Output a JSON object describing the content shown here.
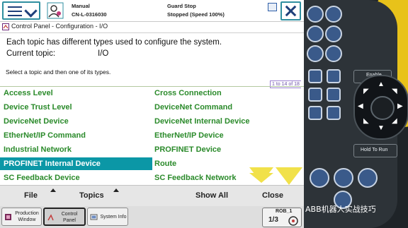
{
  "header": {
    "mode": "Manual",
    "controller_id": "CN-L-0316030",
    "guard_status": "Guard Stop",
    "motor_status": "Stopped (Speed 100%)"
  },
  "window_title": "Control Panel - Configuration - I/O",
  "description": "Each topic has different types used to configure the system.",
  "current_topic_label": "Current topic:",
  "current_topic_value": "I/O",
  "instruction": "Select a topic and then one of its types.",
  "range_indicator": "1 to 14 of 18",
  "types_left": [
    "Access Level",
    "Device Trust Level",
    "DeviceNet Device",
    "EtherNet/IP Command",
    "Industrial Network",
    "PROFINET Internal Device",
    "SC Feedback Device"
  ],
  "types_right": [
    "Cross Connection",
    "DeviceNet Command",
    "DeviceNet Internal Device",
    "EtherNet/IP Device",
    "PROFINET Device",
    "Route",
    "SC Feedback Network"
  ],
  "selected_item": "PROFINET Internal Device",
  "commands": {
    "file": "File",
    "topics": "Topics",
    "show_all": "Show All",
    "close": "Close"
  },
  "taskbar": {
    "production_window": "Production Window",
    "control_panel": "Control Panel",
    "system_info": "System Info",
    "rob_label": "ROB_1",
    "rob_fraction": "1/3"
  },
  "pendant": {
    "enable_label": "Enable",
    "hold_to_run_label": "Hold To Run"
  },
  "watermark": "ABB机器人实战技巧",
  "colors": {
    "selected_bg": "#0b97a6",
    "item_text": "#2a8a2a",
    "scroll_arrows": "#f1e14a",
    "accent_border": "#2f8fa0"
  }
}
